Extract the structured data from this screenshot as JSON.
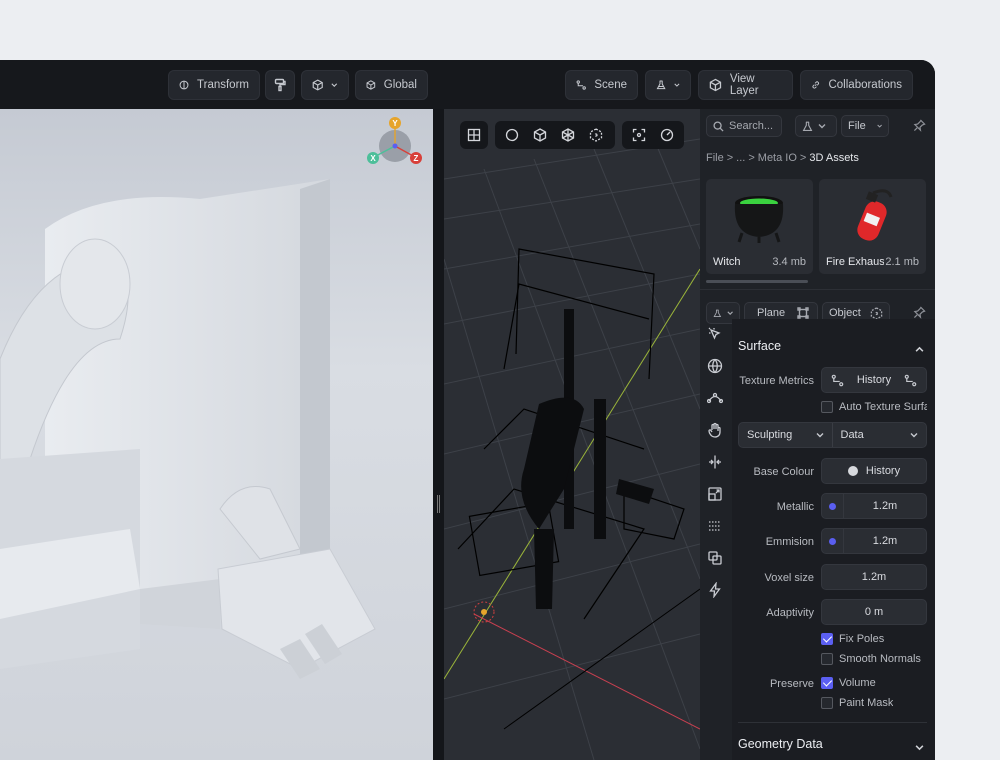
{
  "toolbar": {
    "transform_label": "Transform",
    "global_label": "Global",
    "scene_label": "Scene",
    "view_layer_label": "View Layer",
    "collaborations_label": "Collaborations"
  },
  "gizmo": {
    "y": "Y",
    "x": "X",
    "z": "Z",
    "colors": {
      "y": "#e6a42b",
      "x": "#4dbf9a",
      "z": "#d8403a"
    }
  },
  "panel": {
    "search_placeholder": "Search...",
    "file_label": "File",
    "breadcrumb": {
      "root": "File",
      "sep1": ">",
      "ellipsis": "...",
      "sep2": ">",
      "folder": "Meta IO",
      "sep3": ">",
      "current": "3D Assets"
    },
    "assets": [
      {
        "name": "Witch",
        "size": "3.4 mb"
      },
      {
        "name": "Fire Exhauster",
        "size": "2.1 mb"
      }
    ],
    "plane_label": "Plane",
    "object_label": "Object",
    "surface": {
      "title": "Surface",
      "texture_metrics_label": "Texture Metrics",
      "history_label": "History",
      "auto_texture_label": "Auto Texture Surface",
      "sculpting_label": "Sculpting",
      "data_label": "Data",
      "base_colour_label": "Base Colour",
      "base_colour_value": "History",
      "metallic_label": "Metallic",
      "metallic_value": "1.2m",
      "emmision_label": "Emmision",
      "emmision_value": "1.2m",
      "voxel_label": "Voxel size",
      "voxel_value": "1.2m",
      "adaptivity_label": "Adaptivity",
      "adaptivity_value": "0 m",
      "fix_poles_label": "Fix Poles",
      "smooth_normals_label": "Smooth Normals",
      "preserve_label": "Preserve",
      "volume_label": "Volume",
      "paint_mask_label": "Paint Mask"
    },
    "geometry_title": "Geometry Data"
  },
  "accent": "#5b5ff2"
}
